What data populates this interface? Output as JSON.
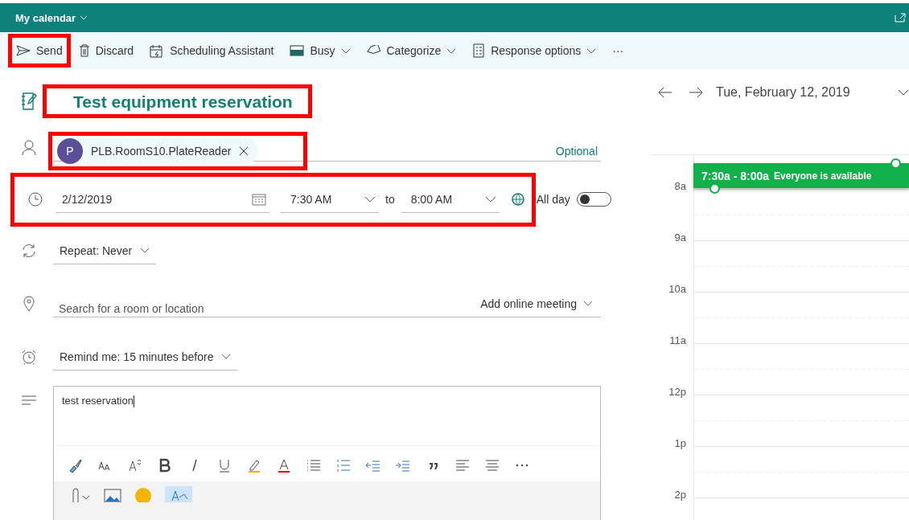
{
  "header": {
    "title": "My calendar"
  },
  "toolbar": [
    {
      "kind": "send",
      "label": "Send",
      "dropdown": false,
      "highlighted": true
    },
    {
      "kind": "discard",
      "label": "Discard",
      "dropdown": false,
      "highlighted": false
    },
    {
      "kind": "scheduling",
      "label": "Scheduling Assistant",
      "dropdown": false,
      "highlighted": false
    },
    {
      "kind": "busy",
      "label": "Busy",
      "dropdown": true,
      "highlighted": false
    },
    {
      "kind": "categorize",
      "label": "Categorize",
      "dropdown": true,
      "highlighted": false
    },
    {
      "kind": "response",
      "label": "Response options",
      "dropdown": true,
      "highlighted": false
    },
    {
      "kind": "more",
      "label": "···",
      "dropdown": false,
      "highlighted": false
    }
  ],
  "event": {
    "title": "Test equipment reservation",
    "title_highlighted": true,
    "attendees": [
      {
        "initial": "P",
        "name": "PLB.RoomS10.PlateReader",
        "color": "#5c4f9a"
      }
    ],
    "attendees_highlighted": true,
    "optional_label": "Optional",
    "date": "2/12/2019",
    "start": "7:30 AM",
    "to_label": "to",
    "end": "8:00 AM",
    "all_day_label": "All day",
    "all_day": false,
    "time_highlighted": true,
    "repeat": "Repeat:  Never",
    "location_placeholder": "Search for a room or location",
    "online_meeting": "Add online meeting",
    "reminder": "Remind me:  15 minutes before",
    "body": "test reservation"
  },
  "calendar": {
    "date": "Tue, February 12, 2019",
    "hours": [
      "8a",
      "9a",
      "10a",
      "11a",
      "12p",
      "1p",
      "2p"
    ],
    "slot": {
      "time": "7:30a - 8:00a",
      "status": "Everyone is available"
    }
  }
}
